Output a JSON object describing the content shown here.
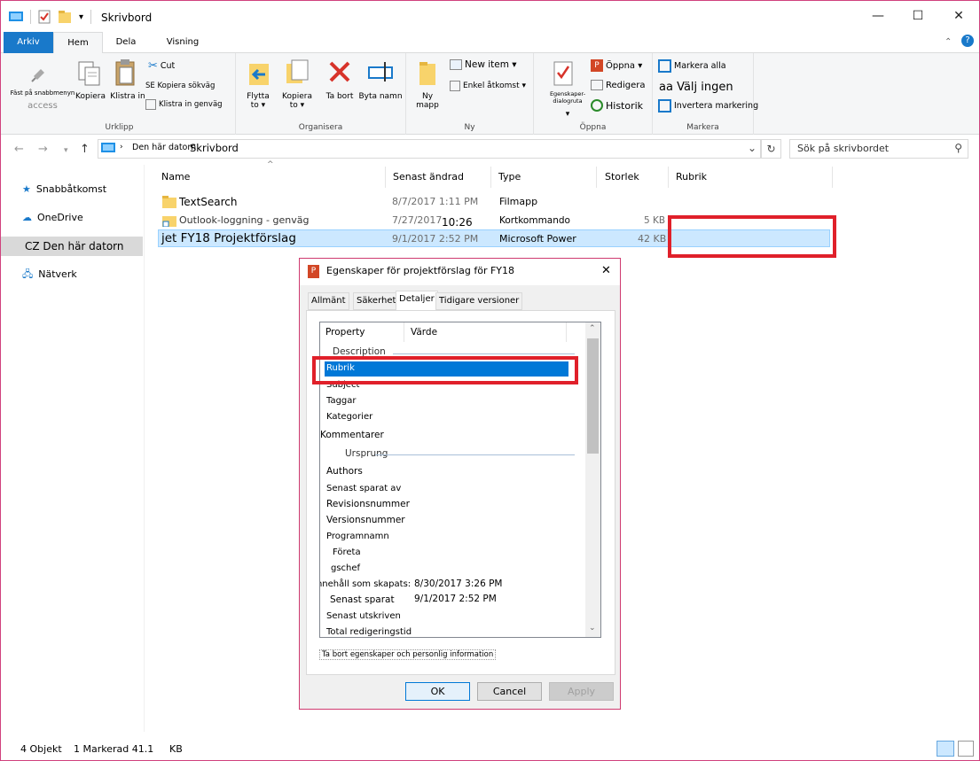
{
  "titlebar": {
    "title": "Skrivbord",
    "minimize": "—",
    "maximize": "☐",
    "close": "✕"
  },
  "tabs": {
    "file": "Arkiv",
    "home": "Hem",
    "share": "Dela",
    "view": "Visning"
  },
  "ribbon": {
    "clipboard": {
      "pin_line1": "Fäst på snabbmenyn",
      "pin_line2": "access",
      "copy": "Kopiera",
      "paste": "Klistra in",
      "cut": "Cut",
      "copy_path": "SE Kopiera sökväg",
      "paste_shortcut": "Klistra in genväg",
      "label": "Urklipp"
    },
    "organize": {
      "move_line1": "Flytta",
      "move_line2": "to ▾",
      "copy_line1": "Kopiera",
      "copy_line2": "to ▾",
      "delete": "Ta bort",
      "rename": "Byta namn",
      "label": "Organisera"
    },
    "new": {
      "folder_line1": "Ny",
      "folder_line2": "mapp",
      "new_item": "New item ▾",
      "easy_access": "Enkel åtkomst ▾",
      "label": "Ny"
    },
    "open": {
      "properties": "Egenskaper-dialogruta",
      "open": "Öppna ▾",
      "edit": "Redigera",
      "history": "Historik",
      "label": "Öppna"
    },
    "select": {
      "select_all": "Markera alla",
      "select_none": "aa Välj ingen",
      "invert": "Invertera markering",
      "label": "Markera"
    }
  },
  "address": {
    "path_root": "Den här datorn",
    "path_current": "Skrivbord",
    "search_placeholder": "Sök på skrivbordet"
  },
  "nav": {
    "quick": "Snabbåtkomst",
    "onedrive": "OneDrive",
    "thispc": "CZ Den här datorn",
    "network": "Nätverk"
  },
  "columns": {
    "name": "Name",
    "modified": "Senast ändrad",
    "type": "Type",
    "size": "Storlek",
    "title": "Rubrik"
  },
  "files": [
    {
      "name": "TextSearch",
      "modified": "8/7/2017 1:11 PM",
      "type": "Filmapp",
      "size": ""
    },
    {
      "name": "Outlook-loggning - genväg",
      "modified": "7/27/2017",
      "modified_time": "10:26",
      "type": "Kortkommando",
      "size": "5 KB"
    },
    {
      "name": "jet FY18 Projektförslag",
      "modified": "9/1/2017 2:52 PM",
      "type": "Microsoft Power",
      "size": "42 KB"
    }
  ],
  "status": {
    "count": "4 Objekt",
    "selected": "1 Markerad 41.1",
    "unit": "KB"
  },
  "dialog": {
    "title": "Egenskaper för projektförslag för FY18",
    "close": "✕",
    "tabs": [
      "Allmänt",
      "Säkerhet",
      "Detaljer",
      "Tidigare versioner"
    ],
    "col_property": "Property",
    "col_value": "Värde",
    "section_description": "Description",
    "section_origin": "Ursprung",
    "items": [
      "Rubrik",
      "Subject",
      "Taggar",
      "Kategorier",
      "Kommentarer",
      "Authors",
      "Senast sparat av",
      "Revisionsnummer",
      "Versionsnummer",
      "Programnamn",
      "Företa",
      "gschef",
      "Innehåll som skapats:",
      "Senast sparat",
      "Senast utskriven",
      "Total redigeringstid"
    ],
    "created_value": "8/30/2017 3:26 PM",
    "saved_value": "9/1/2017 2:52 PM",
    "remove_link": "Ta bort egenskaper och personlig information",
    "ok": "OK",
    "cancel": "Cancel",
    "apply": "Apply"
  }
}
